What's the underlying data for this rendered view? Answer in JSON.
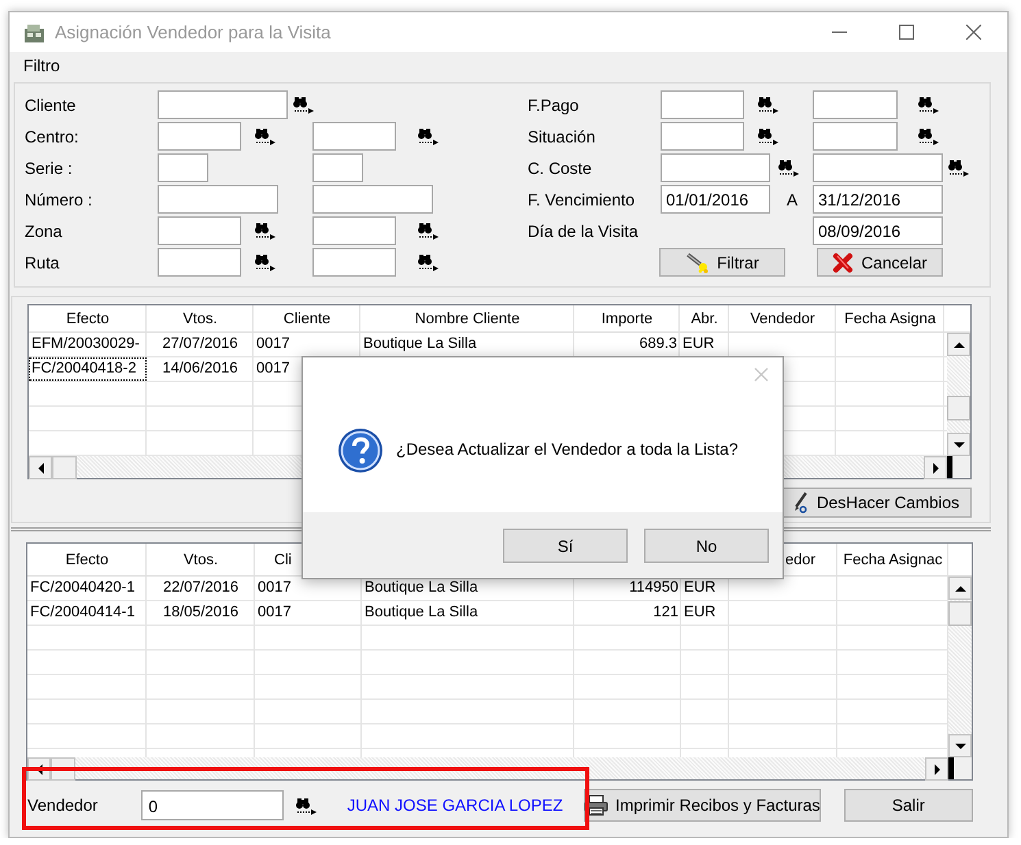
{
  "window": {
    "title": "Asignación Vendedor para la Visita"
  },
  "menu": [
    {
      "label": "Filtro"
    }
  ],
  "filter": {
    "left_rows": [
      {
        "label": "Cliente",
        "kind": "lookup_single"
      },
      {
        "label": "Centro:",
        "kind": "lookup_pair"
      },
      {
        "label": "Serie :",
        "kind": "short_pair"
      },
      {
        "label": "Número :",
        "kind": "wide_pair"
      },
      {
        "label": "Zona",
        "kind": "lookup_pair"
      },
      {
        "label": "Ruta",
        "kind": "lookup_pair"
      }
    ],
    "right_rows": [
      {
        "label": "F.Pago",
        "kind": "lookup_pair"
      },
      {
        "label": "Situación",
        "kind": "lookup_pair"
      },
      {
        "label": "C. Coste",
        "kind": "wide_lookup_pair"
      },
      {
        "label": "F. Vencimiento",
        "kind": "range",
        "from": "01/01/2016",
        "separator": "A",
        "to": "31/12/2016"
      },
      {
        "label": "Día de la Visita",
        "kind": "single",
        "value": "08/09/2016"
      },
      {
        "kind": "buttons",
        "buttons": [
          {
            "label": "Filtrar",
            "kind": "filter"
          },
          {
            "label": "Cancelar",
            "kind": "cancel"
          }
        ]
      }
    ]
  },
  "grid_top": {
    "columns": [
      {
        "label": "Efecto",
        "kind": "text"
      },
      {
        "label": "Vtos.",
        "kind": "date"
      },
      {
        "label": "Cliente",
        "kind": "text"
      },
      {
        "label": "Nombre Cliente",
        "kind": "text"
      },
      {
        "label": "Importe",
        "kind": "amount"
      },
      {
        "label": "Abr.",
        "kind": "text"
      },
      {
        "label": "Vendedor",
        "kind": "text"
      },
      {
        "label": "Fecha Asigna",
        "kind": "text"
      }
    ],
    "rows": [
      {
        "cells": [
          "EFM/20030029-",
          "27/07/2016",
          "0017",
          "Boutique La Silla",
          "689.3",
          "EUR"
        ],
        "focused": false
      },
      {
        "cells": [
          "FC/20040418-2",
          "14/06/2016",
          "0017"
        ],
        "focused": true
      }
    ],
    "buttons": [
      {
        "label": "DesHacer Cambios"
      }
    ]
  },
  "grid_bottom": {
    "columns": [
      {
        "label": "Efecto",
        "kind": "text"
      },
      {
        "label": "Vtos.",
        "kind": "date"
      },
      {
        "label": "Cli",
        "kind": "text"
      },
      {
        "kind": "text"
      },
      {
        "kind": "amount"
      },
      {
        "kind": "text"
      },
      {
        "label": "edor",
        "kind": "text"
      },
      {
        "label": "Fecha Asignac",
        "kind": "text"
      }
    ],
    "rows": [
      {
        "cells": [
          "FC/20040420-1",
          "22/07/2016",
          "0017",
          "Boutique La Silla",
          "114950",
          "EUR"
        ],
        "focused": false
      },
      {
        "cells": [
          "FC/20040414-1",
          "18/05/2016",
          "0017",
          "Boutique La Silla",
          "121",
          "EUR"
        ],
        "focused": false
      }
    ]
  },
  "footer": {
    "label": "Vendedor",
    "value": "0",
    "seller_name": "JUAN JOSE GARCIA LOPEZ",
    "highlighted": true,
    "buttons": [
      {
        "label": "Imprimir Recibos y Facturas",
        "kind": "print"
      },
      {
        "label": "Salir",
        "kind": "exit"
      }
    ]
  },
  "dialog": {
    "message": "¿Desea Actualizar el Vendedor a toda la Lista?",
    "buttons": [
      {
        "label": "Sí"
      },
      {
        "label": "No"
      }
    ]
  }
}
